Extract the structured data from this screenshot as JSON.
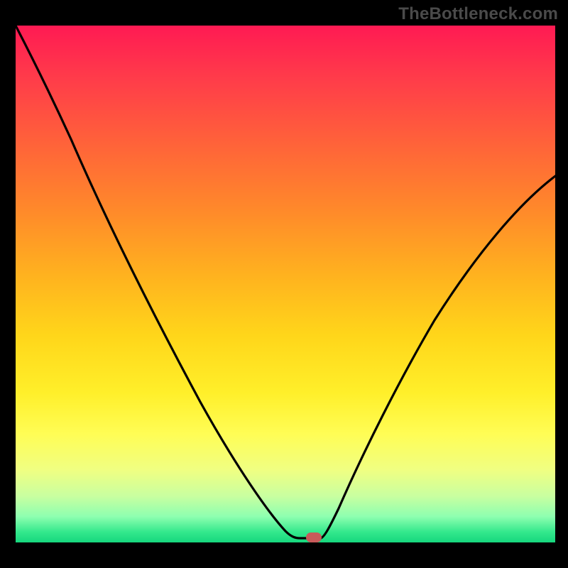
{
  "watermark": {
    "text": "TheBottleneck.com"
  },
  "chart_data": {
    "type": "line",
    "title": "",
    "xlabel": "",
    "ylabel": "",
    "xlim": [
      0,
      100
    ],
    "ylim": [
      0,
      100
    ],
    "grid": false,
    "series": [
      {
        "name": "bottleneck-curve",
        "x": [
          0,
          5,
          10,
          15,
          20,
          25,
          30,
          35,
          40,
          45,
          50,
          52,
          55,
          57,
          60,
          65,
          70,
          75,
          80,
          85,
          90,
          95,
          100
        ],
        "values": [
          100,
          92,
          85,
          77,
          68,
          59,
          50,
          40,
          30,
          18,
          6,
          1,
          0,
          0,
          10,
          25,
          36,
          45,
          52,
          58,
          63,
          67,
          70
        ]
      }
    ],
    "marker": {
      "x": 55,
      "y": 0,
      "color": "#c85a5a"
    },
    "background_gradient": [
      "#ff1a53",
      "#ffb11f",
      "#ffef2a",
      "#16d77e"
    ]
  }
}
